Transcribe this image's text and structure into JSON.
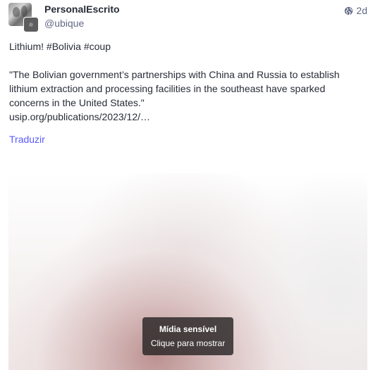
{
  "post": {
    "display_name": "PersonalEscrito",
    "handle": "@ubique",
    "visibility_icon": "globe-icon",
    "timestamp": "2d",
    "paragraph1": {
      "text": "Lithium! ",
      "hashtags": [
        "#Bolivia",
        "#coup"
      ]
    },
    "paragraph2": {
      "quote": "\"The Bolivian government’s partnerships with China and Russia to establish lithium extraction and processing facilities in the southeast have sparked concerns in the United States.\"",
      "link": "usip.org/publications/2023/12/…"
    },
    "translate_label": "Traduzir",
    "translate_color": "#595aff"
  },
  "media": {
    "spoiler_title": "Mídia sensível",
    "spoiler_subtitle": "Clique para mostrar"
  }
}
